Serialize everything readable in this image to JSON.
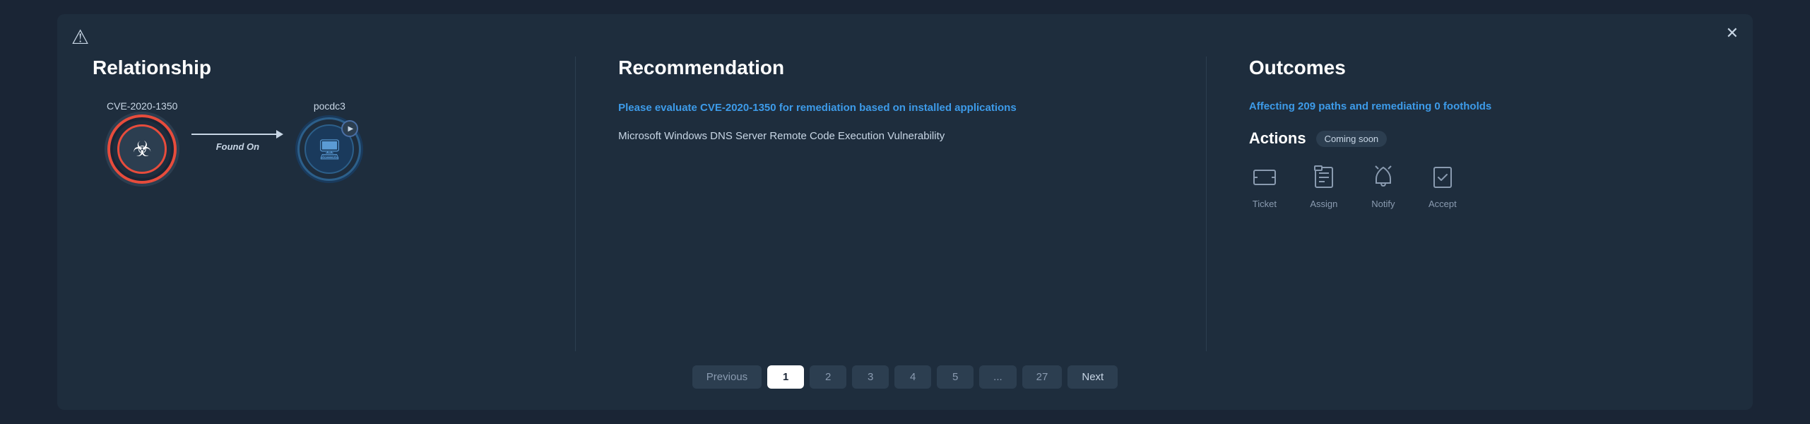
{
  "modal": {
    "logo": "⚠",
    "close": "✕"
  },
  "relationship": {
    "title": "Relationship",
    "cve_label": "CVE-2020-1350",
    "cve_icon": "☣",
    "arrow_label": "Found On",
    "target_label": "pocdc3",
    "target_icon": "🖥",
    "play_icon": "▶"
  },
  "recommendation": {
    "title": "Recommendation",
    "link_text": "Please evaluate CVE-2020-1350 for remediation based on installed applications",
    "description": "Microsoft Windows DNS Server Remote Code Execution Vulnerability"
  },
  "outcomes": {
    "title": "Outcomes",
    "link_text": "Affecting 209 paths and remediating 0 footholds",
    "actions_title": "Actions",
    "coming_soon": "Coming soon",
    "actions": [
      {
        "name": "Ticket",
        "icon": "🖨"
      },
      {
        "name": "Assign",
        "icon": "📋"
      },
      {
        "name": "Notify",
        "icon": "🔔"
      },
      {
        "name": "Accept",
        "icon": "✅"
      }
    ]
  },
  "pagination": {
    "previous": "Previous",
    "next": "Next",
    "pages": [
      "1",
      "2",
      "3",
      "4",
      "5",
      "...",
      "27"
    ],
    "active_page": "1"
  }
}
